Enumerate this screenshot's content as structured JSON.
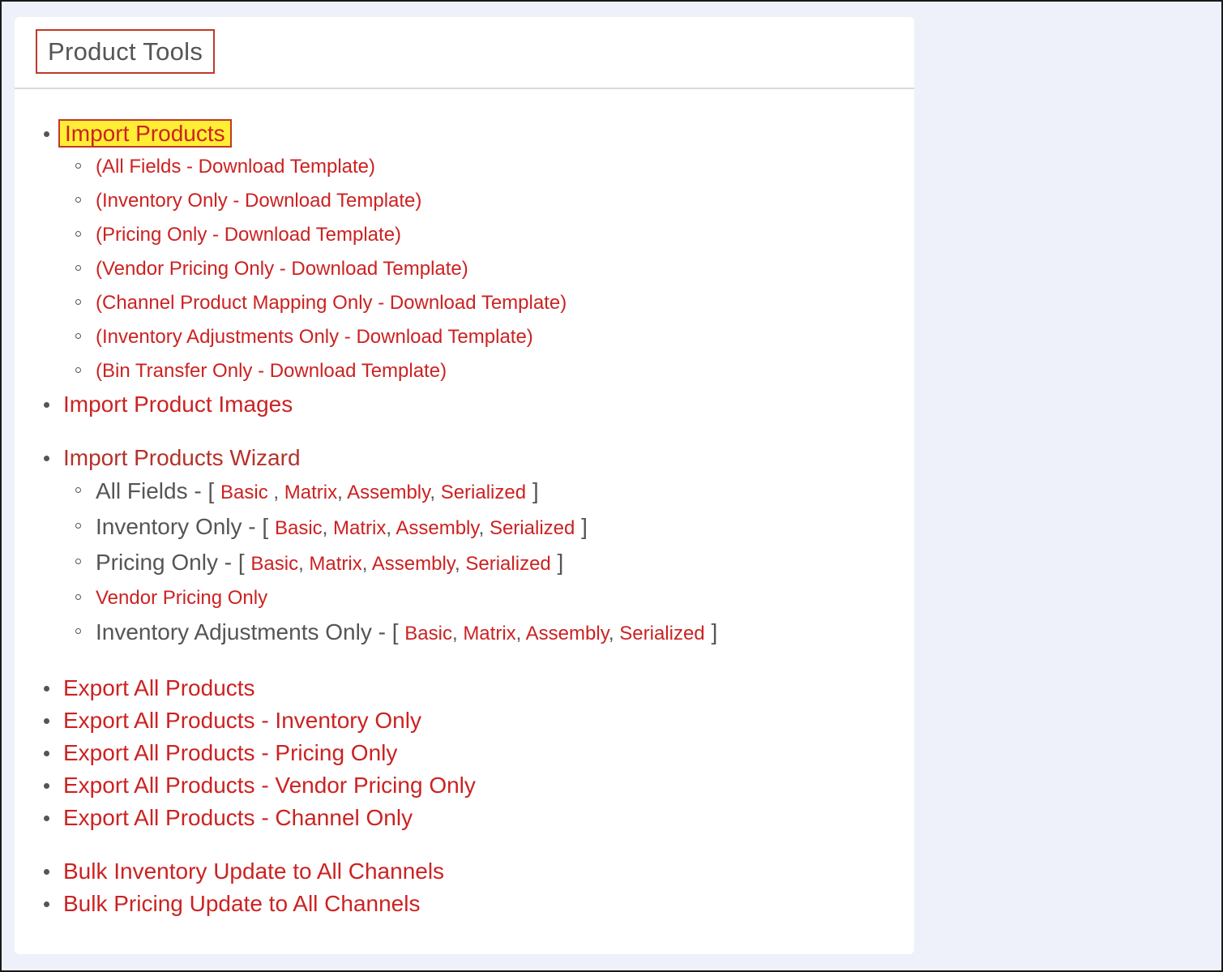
{
  "panel": {
    "title": "Product Tools"
  },
  "import_products": {
    "label": "Import Products",
    "templates": [
      "(All Fields - Download Template)",
      "(Inventory Only - Download Template)",
      "(Pricing Only - Download Template)",
      "(Vendor Pricing Only - Download Template)",
      "(Channel Product Mapping Only - Download Template)",
      "(Inventory Adjustments Only - Download Template)",
      "(Bin Transfer Only - Download Template)"
    ]
  },
  "import_product_images": {
    "label": "Import Product Images"
  },
  "wizard": {
    "label": "Import Products Wizard",
    "open_bracket": "[",
    "close_bracket": "]",
    "rows": [
      {
        "label": "All Fields - ",
        "options": [
          "Basic",
          "Matrix",
          "Assembly",
          "Serialized"
        ],
        "separators": [
          " , ",
          ", ",
          ", "
        ]
      },
      {
        "label": "Inventory Only - ",
        "options": [
          "Basic",
          "Matrix",
          "Assembly",
          "Serialized"
        ],
        "separators": [
          ", ",
          ", ",
          ", "
        ]
      },
      {
        "label": "Pricing Only - ",
        "options": [
          "Basic",
          "Matrix",
          "Assembly",
          "Serialized"
        ],
        "separators": [
          ", ",
          ", ",
          ", "
        ]
      },
      {
        "label": "Inventory Adjustments Only - ",
        "options": [
          "Basic",
          "Matrix",
          "Assembly",
          "Serialized"
        ],
        "separators": [
          ", ",
          ", ",
          ", "
        ]
      }
    ],
    "vendor_pricing_link": "Vendor Pricing Only"
  },
  "exports": [
    "Export All Products",
    "Export All Products - Inventory Only",
    "Export All Products - Pricing Only",
    "Export All Products - Vendor Pricing Only",
    "Export All Products - Channel Only"
  ],
  "bulk": [
    "Bulk Inventory Update to All Channels",
    "Bulk Pricing Update to All Channels"
  ],
  "colors": {
    "link": "#cc2222",
    "highlight": "#ffee33",
    "highlight_border": "#c0392b",
    "background": "#eef0fa"
  }
}
